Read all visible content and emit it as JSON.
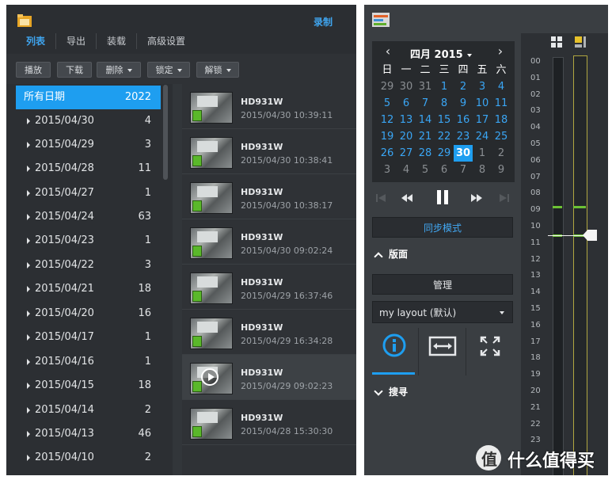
{
  "left": {
    "header_right": "录制",
    "tabs": [
      "列表",
      "导出",
      "装载",
      "高级设置"
    ],
    "toolbar": {
      "play": "播放",
      "download": "下载",
      "delete": "删除",
      "lock": "锁定",
      "unlock": "解锁"
    },
    "dates": [
      {
        "label": "所有日期",
        "count": "2022"
      },
      {
        "label": "2015/04/30",
        "count": "4"
      },
      {
        "label": "2015/04/29",
        "count": "3"
      },
      {
        "label": "2015/04/28",
        "count": "11"
      },
      {
        "label": "2015/04/27",
        "count": "1"
      },
      {
        "label": "2015/04/24",
        "count": "63"
      },
      {
        "label": "2015/04/23",
        "count": "1"
      },
      {
        "label": "2015/04/22",
        "count": "3"
      },
      {
        "label": "2015/04/21",
        "count": "18"
      },
      {
        "label": "2015/04/20",
        "count": "16"
      },
      {
        "label": "2015/04/17",
        "count": "1"
      },
      {
        "label": "2015/04/16",
        "count": "1"
      },
      {
        "label": "2015/04/15",
        "count": "18"
      },
      {
        "label": "2015/04/14",
        "count": "2"
      },
      {
        "label": "2015/04/13",
        "count": "46"
      },
      {
        "label": "2015/04/10",
        "count": "2"
      }
    ],
    "clips": [
      {
        "camera": "HD931W",
        "time": "2015/04/30 10:39:11"
      },
      {
        "camera": "HD931W",
        "time": "2015/04/30 10:38:41"
      },
      {
        "camera": "HD931W",
        "time": "2015/04/30 10:38:17"
      },
      {
        "camera": "HD931W",
        "time": "2015/04/30 09:02:24"
      },
      {
        "camera": "HD931W",
        "time": "2015/04/29 16:37:46"
      },
      {
        "camera": "HD931W",
        "time": "2015/04/29 16:34:28"
      },
      {
        "camera": "HD931W",
        "time": "2015/04/29 09:02:23"
      },
      {
        "camera": "HD931W",
        "time": "2015/04/28 15:30:30"
      }
    ]
  },
  "right": {
    "calendar": {
      "title": "四月 2015",
      "weekdays": [
        "日",
        "一",
        "二",
        "三",
        "四",
        "五",
        "六"
      ],
      "weeks": [
        [
          "29",
          "30",
          "31",
          "1",
          "2",
          "3",
          "4"
        ],
        [
          "5",
          "6",
          "7",
          "8",
          "9",
          "10",
          "11"
        ],
        [
          "12",
          "13",
          "14",
          "15",
          "16",
          "17",
          "18"
        ],
        [
          "19",
          "20",
          "21",
          "22",
          "23",
          "24",
          "25"
        ],
        [
          "26",
          "27",
          "28",
          "29",
          "30",
          "1",
          "2"
        ],
        [
          "3",
          "4",
          "5",
          "6",
          "7",
          "8",
          "9"
        ]
      ],
      "selected_day": "30"
    },
    "sync_button": "同步模式",
    "layout_section": "版面",
    "manage_button": "管理",
    "layout_select": "my layout (默认)",
    "search_section": "搜寻",
    "hours": [
      "00",
      "01",
      "02",
      "03",
      "04",
      "05",
      "06",
      "07",
      "08",
      "09",
      "10",
      "11",
      "12",
      "13",
      "14",
      "15",
      "16",
      "17",
      "18",
      "19",
      "20",
      "21",
      "22",
      "23"
    ]
  },
  "watermark": {
    "logo": "值",
    "text": "什么值得买"
  },
  "colors": {
    "accent": "#1e9ef0",
    "panel": "#32363a",
    "green": "#6dc235"
  }
}
